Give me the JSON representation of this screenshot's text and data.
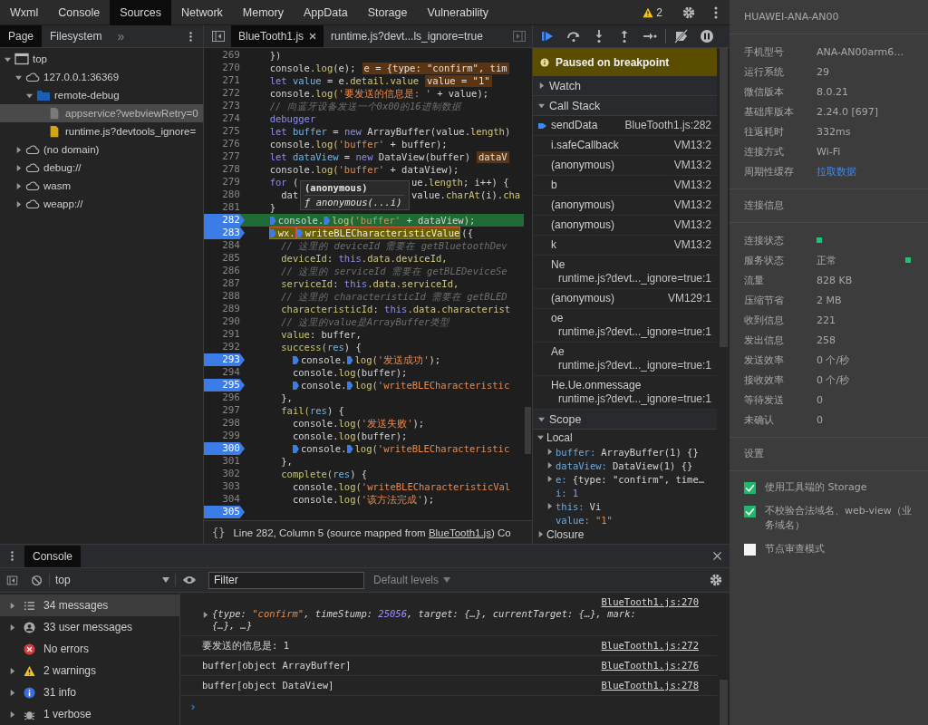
{
  "top_tabs": [
    {
      "label": "Wxml",
      "selected": false
    },
    {
      "label": "Console",
      "selected": false
    },
    {
      "label": "Sources",
      "selected": true
    },
    {
      "label": "Network",
      "selected": false
    },
    {
      "label": "Memory",
      "selected": false
    },
    {
      "label": "AppData",
      "selected": false
    },
    {
      "label": "Storage",
      "selected": false
    },
    {
      "label": "Vulnerability",
      "selected": false
    }
  ],
  "warning_count": "2",
  "sources_sidebar": {
    "tabs": [
      {
        "label": "Page",
        "selected": true
      },
      {
        "label": "Filesystem",
        "selected": false
      }
    ],
    "more": "»",
    "tree": [
      {
        "label": "top",
        "kind": "frame",
        "expanded": true,
        "selected": false,
        "children": [
          {
            "label": "127.0.0.1:36369",
            "kind": "domain",
            "expanded": true,
            "selected": false,
            "children": [
              {
                "label": "remote-debug",
                "kind": "folder",
                "expanded": true,
                "selected": false,
                "children": [
                  {
                    "label": "appservice?webviewRetry=0",
                    "kind": "file",
                    "selected": true
                  },
                  {
                    "label": "runtime.js?devtools_ignore=",
                    "kind": "script",
                    "selected": false
                  }
                ]
              }
            ]
          },
          {
            "label": "(no domain)",
            "kind": "domain",
            "expanded": false,
            "selected": false
          },
          {
            "label": "debug://",
            "kind": "domain",
            "expanded": false,
            "selected": false
          },
          {
            "label": "wasm",
            "kind": "domain",
            "expanded": false,
            "selected": false
          },
          {
            "label": "weapp://",
            "kind": "domain",
            "expanded": false,
            "selected": false
          }
        ]
      }
    ]
  },
  "editor": {
    "tabs": [
      {
        "label": "BlueTooth1.js",
        "selected": true,
        "closable": true
      },
      {
        "label": "runtime.js?devt...ls_ignore=true",
        "selected": false,
        "closable": false
      }
    ],
    "lines": [
      {
        "number": "269",
        "breakpoint": false,
        "current": false,
        "segments": [
          {
            "kind": "p",
            "text": "  })"
          }
        ]
      },
      {
        "number": "270",
        "breakpoint": false,
        "current": false,
        "segments": [
          {
            "kind": "p",
            "text": "  console."
          },
          {
            "kind": "fn",
            "text": "log"
          },
          {
            "kind": "p",
            "text": "(e);"
          }
        ],
        "inline_value": "e = {type: \"confirm\", tim"
      },
      {
        "number": "271",
        "breakpoint": false,
        "current": false,
        "segments": [
          {
            "kind": "kw",
            "text": "  let"
          },
          {
            "kind": "var",
            "text": " value"
          },
          {
            "kind": "p",
            "text": " = e."
          },
          {
            "kind": "fn",
            "text": "detail.value"
          }
        ],
        "inline_value": "value = \"1\""
      },
      {
        "number": "272",
        "breakpoint": false,
        "current": false,
        "segments": [
          {
            "kind": "p",
            "text": "  console."
          },
          {
            "kind": "fn",
            "text": "log("
          },
          {
            "kind": "str",
            "text": "'要发送的信息是: '"
          },
          {
            "kind": "p",
            "text": " + value);"
          }
        ]
      },
      {
        "number": "273",
        "breakpoint": false,
        "current": false,
        "segments": [
          {
            "kind": "cm",
            "text": "  // 向蓝牙设备发送一个0x00的16进制数据"
          }
        ]
      },
      {
        "number": "274",
        "breakpoint": false,
        "current": false,
        "segments": [
          {
            "kind": "kw",
            "text": "  debugger"
          }
        ]
      },
      {
        "number": "275",
        "breakpoint": false,
        "current": false,
        "segments": [
          {
            "kind": "kw",
            "text": "  let"
          },
          {
            "kind": "var",
            "text": " buffer"
          },
          {
            "kind": "p",
            "text": " = "
          },
          {
            "kind": "kw",
            "text": "new"
          },
          {
            "kind": "p",
            "text": " ArrayBuffer(value."
          },
          {
            "kind": "fn",
            "text": "length"
          },
          {
            "kind": "p",
            "text": ")"
          }
        ]
      },
      {
        "number": "276",
        "breakpoint": false,
        "current": false,
        "segments": [
          {
            "kind": "p",
            "text": "  console."
          },
          {
            "kind": "fn",
            "text": "log("
          },
          {
            "kind": "str",
            "text": "'buffer'"
          },
          {
            "kind": "p",
            "text": " + buffer);"
          }
        ]
      },
      {
        "number": "277",
        "breakpoint": false,
        "current": false,
        "segments": [
          {
            "kind": "kw",
            "text": "  let"
          },
          {
            "kind": "var",
            "text": " dataView"
          },
          {
            "kind": "p",
            "text": " = "
          },
          {
            "kind": "kw",
            "text": "new"
          },
          {
            "kind": "p",
            "text": " DataView(buffer)"
          }
        ],
        "inline_value": "dataV"
      },
      {
        "number": "278",
        "breakpoint": false,
        "current": false,
        "segments": [
          {
            "kind": "p",
            "text": "  console."
          },
          {
            "kind": "fn",
            "text": "log("
          },
          {
            "kind": "str",
            "text": "'buffer'"
          },
          {
            "kind": "p",
            "text": " + dataView);"
          }
        ]
      },
      {
        "number": "279",
        "breakpoint": false,
        "current": false,
        "segments": [
          {
            "kind": "kw",
            "text": "  for"
          },
          {
            "kind": "p",
            "text": " ("
          }
        ],
        "segments_after": [
          {
            "kind": "p",
            "text": "ue."
          },
          {
            "kind": "fn",
            "text": "length"
          },
          {
            "kind": "p",
            "text": "; i++) {"
          }
        ]
      },
      {
        "number": "280",
        "breakpoint": false,
        "current": false,
        "segments": [
          {
            "kind": "p",
            "text": "    dat"
          }
        ],
        "segments_after": [
          {
            "kind": "p",
            "text": "value."
          },
          {
            "kind": "fn",
            "text": "charAt"
          },
          {
            "kind": "p",
            "text": "(i)."
          },
          {
            "kind": "fn",
            "text": "cha"
          }
        ]
      },
      {
        "number": "281",
        "breakpoint": false,
        "current": false,
        "segments": [
          {
            "kind": "p",
            "text": "  }"
          }
        ]
      },
      {
        "number": "282",
        "breakpoint": true,
        "current": true,
        "segments": [
          {
            "kind": "p",
            "text": "  console.",
            "marker": true
          },
          {
            "kind": "fn",
            "text": "log(",
            "marker": true
          },
          {
            "kind": "str",
            "text": "'buffer'"
          },
          {
            "kind": "p",
            "text": " + dataView);"
          }
        ]
      },
      {
        "number": "283",
        "breakpoint": true,
        "current": false,
        "segments": [
          {
            "kind": "hl",
            "text": "  wx.",
            "marker": true
          },
          {
            "kind": "hl",
            "text": "writeBLECharacteristicValue",
            "marker": true
          },
          {
            "kind": "p",
            "text": "({"
          }
        ]
      },
      {
        "number": "284",
        "breakpoint": false,
        "current": false,
        "segments": [
          {
            "kind": "cm",
            "text": "    // 这里的 deviceId 需要在 getBluetoothDev"
          }
        ]
      },
      {
        "number": "285",
        "breakpoint": false,
        "current": false,
        "segments": [
          {
            "kind": "key",
            "text": "    deviceId"
          },
          {
            "kind": "p",
            "text": ": "
          },
          {
            "kind": "kw",
            "text": "this"
          },
          {
            "kind": "fn",
            "text": ".data.deviceId,"
          }
        ]
      },
      {
        "number": "286",
        "breakpoint": false,
        "current": false,
        "segments": [
          {
            "kind": "cm",
            "text": "    // 这里的 serviceId 需要在 getBLEDeviceSe"
          }
        ]
      },
      {
        "number": "287",
        "breakpoint": false,
        "current": false,
        "segments": [
          {
            "kind": "key",
            "text": "    serviceId"
          },
          {
            "kind": "p",
            "text": ": "
          },
          {
            "kind": "kw",
            "text": "this"
          },
          {
            "kind": "fn",
            "text": ".data.serviceId,"
          }
        ]
      },
      {
        "number": "288",
        "breakpoint": false,
        "current": false,
        "segments": [
          {
            "kind": "cm",
            "text": "    // 这里的 characteristicId 需要在 getBLED"
          }
        ]
      },
      {
        "number": "289",
        "breakpoint": false,
        "current": false,
        "segments": [
          {
            "kind": "key",
            "text": "    characteristicId"
          },
          {
            "kind": "p",
            "text": ": "
          },
          {
            "kind": "kw",
            "text": "this"
          },
          {
            "kind": "fn",
            "text": ".data.characterist"
          }
        ]
      },
      {
        "number": "290",
        "breakpoint": false,
        "current": false,
        "segments": [
          {
            "kind": "cm",
            "text": "    // 这里的value是ArrayBuffer类型"
          }
        ]
      },
      {
        "number": "291",
        "breakpoint": false,
        "current": false,
        "segments": [
          {
            "kind": "key",
            "text": "    value"
          },
          {
            "kind": "p",
            "text": ": buffer,"
          }
        ]
      },
      {
        "number": "292",
        "breakpoint": false,
        "current": false,
        "segments": [
          {
            "kind": "key",
            "text": "    success("
          },
          {
            "kind": "var",
            "text": "res"
          },
          {
            "kind": "p",
            "text": ") {"
          }
        ]
      },
      {
        "number": "293",
        "breakpoint": true,
        "current": false,
        "segments": [
          {
            "kind": "p",
            "text": "      console.",
            "marker": true
          },
          {
            "kind": "fn",
            "text": "log(",
            "marker": true
          },
          {
            "kind": "str",
            "text": "'发送成功'"
          },
          {
            "kind": "p",
            "text": ");"
          }
        ]
      },
      {
        "number": "294",
        "breakpoint": false,
        "current": false,
        "segments": [
          {
            "kind": "p",
            "text": "      console."
          },
          {
            "kind": "fn",
            "text": "log"
          },
          {
            "kind": "p",
            "text": "(buffer);"
          }
        ]
      },
      {
        "number": "295",
        "breakpoint": true,
        "current": false,
        "segments": [
          {
            "kind": "p",
            "text": "      console.",
            "marker": true
          },
          {
            "kind": "fn",
            "text": "log(",
            "marker": true
          },
          {
            "kind": "str",
            "text": "'writeBLECharacteristic"
          }
        ]
      },
      {
        "number": "296",
        "breakpoint": false,
        "current": false,
        "segments": [
          {
            "kind": "p",
            "text": "    },"
          }
        ]
      },
      {
        "number": "297",
        "breakpoint": false,
        "current": false,
        "segments": [
          {
            "kind": "key",
            "text": "    fail("
          },
          {
            "kind": "var",
            "text": "res"
          },
          {
            "kind": "p",
            "text": ") {"
          }
        ]
      },
      {
        "number": "298",
        "breakpoint": false,
        "current": false,
        "segments": [
          {
            "kind": "p",
            "text": "      console."
          },
          {
            "kind": "fn",
            "text": "log("
          },
          {
            "kind": "str",
            "text": "'发送失败'"
          },
          {
            "kind": "p",
            "text": ");"
          }
        ]
      },
      {
        "number": "299",
        "breakpoint": false,
        "current": false,
        "segments": [
          {
            "kind": "p",
            "text": "      console."
          },
          {
            "kind": "fn",
            "text": "log"
          },
          {
            "kind": "p",
            "text": "(buffer);"
          }
        ]
      },
      {
        "number": "300",
        "breakpoint": true,
        "current": false,
        "segments": [
          {
            "kind": "p",
            "text": "      console.",
            "marker": true
          },
          {
            "kind": "fn",
            "text": "log(",
            "marker": true
          },
          {
            "kind": "str",
            "text": "'writeBLECharacteristic"
          }
        ]
      },
      {
        "number": "301",
        "breakpoint": false,
        "current": false,
        "segments": [
          {
            "kind": "p",
            "text": "    },"
          }
        ]
      },
      {
        "number": "302",
        "breakpoint": false,
        "current": false,
        "segments": [
          {
            "kind": "key",
            "text": "    complete("
          },
          {
            "kind": "var",
            "text": "res"
          },
          {
            "kind": "p",
            "text": ") {"
          }
        ]
      },
      {
        "number": "303",
        "breakpoint": false,
        "current": false,
        "segments": [
          {
            "kind": "p",
            "text": "      console."
          },
          {
            "kind": "fn",
            "text": "log("
          },
          {
            "kind": "str",
            "text": "'writeBLECharacteristicVal"
          }
        ]
      },
      {
        "number": "304",
        "breakpoint": false,
        "current": false,
        "segments": [
          {
            "kind": "p",
            "text": "      console."
          },
          {
            "kind": "fn",
            "text": "log("
          },
          {
            "kind": "str",
            "text": "'该方法完成'"
          },
          {
            "kind": "p",
            "text": ");"
          }
        ]
      },
      {
        "number": "305",
        "breakpoint": true,
        "current": false
      }
    ],
    "tooltip": {
      "title": "(anonymous)",
      "signature": "ƒ anonymous(...i)"
    },
    "format_button": "{}",
    "status": {
      "before": "Line 282, Column 5  (source mapped from ",
      "link": "BlueTooth1.js",
      "after": ") Co"
    }
  },
  "debugger": {
    "paused_message": "Paused on breakpoint",
    "watch": {
      "title": "Watch",
      "expanded": false
    },
    "call_stack": {
      "title": "Call Stack",
      "expanded": true,
      "frames": [
        {
          "name": "sendData",
          "location": "BlueTooth1.js:282",
          "selected": true
        },
        {
          "name": "i.safeCallback",
          "location": "VM13:2",
          "selected": false
        },
        {
          "name": "(anonymous)",
          "location": "VM13:2",
          "selected": false
        },
        {
          "name": "b",
          "location": "VM13:2",
          "selected": false
        },
        {
          "name": "(anonymous)",
          "location": "VM13:2",
          "selected": false
        },
        {
          "name": "(anonymous)",
          "location": "VM13:2",
          "selected": false
        },
        {
          "name": "k",
          "location": "VM13:2",
          "selected": false
        },
        {
          "name": "Ne",
          "location": "runtime.js?devt..._ignore=true:1",
          "selected": false
        },
        {
          "name": "(anonymous)",
          "location": "VM129:1",
          "selected": false
        },
        {
          "name": "oe",
          "location": "runtime.js?devt..._ignore=true:1",
          "selected": false
        },
        {
          "name": "Ae",
          "location": "runtime.js?devt..._ignore=true:1",
          "selected": false
        },
        {
          "name": "He.Ue.onmessage",
          "location": "runtime.js?devt..._ignore=true:1",
          "selected": false
        }
      ]
    },
    "scope": {
      "title": "Scope",
      "expanded": true,
      "groups": [
        {
          "title": "Local",
          "expanded": true,
          "properties": [
            {
              "name": "buffer:",
              "value": "ArrayBuffer(1) {}",
              "kind": "object",
              "expandable": true
            },
            {
              "name": "dataView:",
              "value": "DataView(1) {}",
              "kind": "object",
              "expandable": true
            },
            {
              "name": "e:",
              "value": "{type: \"confirm\", time…",
              "kind": "object",
              "expandable": true
            },
            {
              "name": "i:",
              "value": "1",
              "kind": "number",
              "expandable": false
            },
            {
              "name": "this:",
              "value": "Vi",
              "kind": "object",
              "expandable": true
            },
            {
              "name": "value:",
              "value": "\"1\"",
              "kind": "string",
              "expandable": false
            }
          ]
        },
        {
          "title": "Closure",
          "expanded": false
        }
      ]
    }
  },
  "device_panel": {
    "title": "HUAWEI-ANA-AN00",
    "info": [
      {
        "label": "手机型号",
        "value": "ANA-AN00arm6…",
        "kind": "text"
      },
      {
        "label": "运行系统",
        "value": "29",
        "kind": "text"
      },
      {
        "label": "微信版本",
        "value": "8.0.21",
        "kind": "text"
      },
      {
        "label": "基础库版本",
        "value": "2.24.0 [697]",
        "kind": "text"
      },
      {
        "label": "往返耗时",
        "value": "332ms",
        "kind": "text"
      },
      {
        "label": "连接方式",
        "value": "Wi-Fi",
        "kind": "text"
      },
      {
        "label": "周期性缓存",
        "value": "拉取数据",
        "kind": "link"
      }
    ],
    "connection_title": "连接信息",
    "connection": [
      {
        "label": "连接状态",
        "color": "#1fc271"
      },
      {
        "label": "服务状态",
        "value": "正常",
        "color": "#1fc271"
      },
      {
        "label": "流量",
        "value": "828 KB"
      },
      {
        "label": "压缩节省",
        "value": "2 MB"
      },
      {
        "label": "收到信息",
        "value": "221"
      },
      {
        "label": "发出信息",
        "value": "258"
      },
      {
        "label": "发送效率",
        "value": "0 个/秒"
      },
      {
        "label": "接收效率",
        "value": "0 个/秒"
      },
      {
        "label": "等待发送",
        "value": "0"
      },
      {
        "label": "未确认",
        "value": "0"
      }
    ],
    "settings_title": "设置",
    "settings": [
      {
        "label": "使用工具端的 Storage",
        "checked": true
      },
      {
        "label": "不校验合法域名、web-view（业务域名）",
        "checked": true
      },
      {
        "label": "节点审查模式",
        "checked": false
      }
    ]
  },
  "console": {
    "tab": "Console",
    "context": "top",
    "filter_placeholder": "Filter",
    "levels": "Default levels",
    "sidebar": [
      {
        "label": "34 messages",
        "kind": "messages",
        "selected": true,
        "expandable": true
      },
      {
        "label": "33 user messages",
        "kind": "user",
        "selected": false,
        "expandable": true
      },
      {
        "label": "No errors",
        "kind": "error",
        "selected": false,
        "expandable": false
      },
      {
        "label": "2 warnings",
        "kind": "warning",
        "selected": false,
        "expandable": true
      },
      {
        "label": "31 info",
        "kind": "info",
        "selected": false,
        "expandable": true
      },
      {
        "label": "1 verbose",
        "kind": "verbose",
        "selected": false,
        "expandable": true
      }
    ],
    "messages": [
      {
        "source": "BlueTooth1.js:270",
        "expandable": true,
        "segments": [
          {
            "kind": "p",
            "text": "{type: "
          },
          {
            "kind": "str",
            "text": "\"confirm\""
          },
          {
            "kind": "p",
            "text": ", timeStump: "
          },
          {
            "kind": "num",
            "text": "25056"
          },
          {
            "kind": "p",
            "text": ", target: {…}, currentTarget: {…}, mark: {…}, …}"
          }
        ]
      },
      {
        "source": "BlueTooth1.js:272",
        "expandable": false,
        "segments": [
          {
            "kind": "p",
            "text": "要发送的信息是: 1"
          }
        ]
      },
      {
        "source": "BlueTooth1.js:276",
        "expandable": false,
        "segments": [
          {
            "kind": "p",
            "text": "buffer[object ArrayBuffer]"
          }
        ]
      },
      {
        "source": "BlueTooth1.js:278",
        "expandable": false,
        "segments": [
          {
            "kind": "p",
            "text": "buffer[object DataView]"
          }
        ]
      }
    ],
    "prompt": "›"
  }
}
